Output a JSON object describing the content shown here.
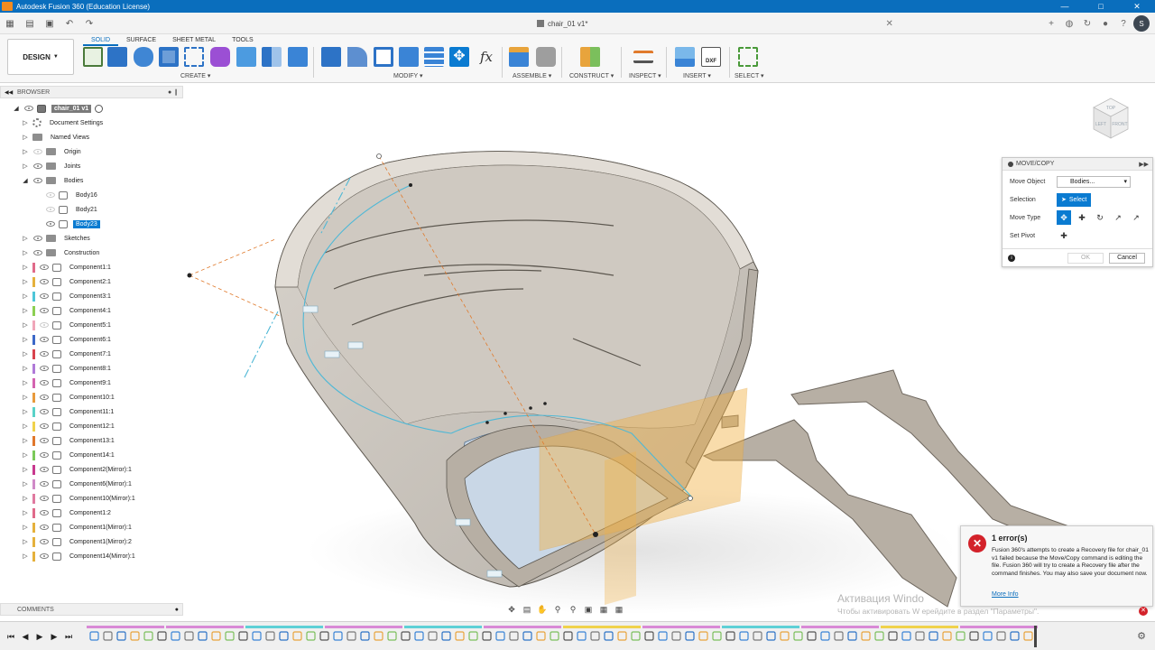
{
  "window": {
    "title": "Autodesk Fusion 360 (Education License)",
    "document_tab": "chair_01 v1*"
  },
  "user": {
    "initials": "S"
  },
  "ribbon": {
    "workspace": "DESIGN",
    "tabs": [
      "SOLID",
      "SURFACE",
      "SHEET METAL",
      "TOOLS"
    ],
    "active_tab": "SOLID",
    "groups": {
      "create": "CREATE",
      "modify": "MODIFY",
      "assemble": "ASSEMBLE",
      "construct": "CONSTRUCT",
      "inspect": "INSPECT",
      "insert": "INSERT",
      "select": "SELECT"
    },
    "fx_label": "fx",
    "dxf_label": "DXF"
  },
  "browser": {
    "header": "BROWSER",
    "root": "chair_01 v1",
    "items": [
      {
        "label": "Document Settings",
        "icon": "gear-icon"
      },
      {
        "label": "Named Views",
        "icon": "folder-icon"
      },
      {
        "label": "Origin",
        "icon": "folder-icon"
      },
      {
        "label": "Joints",
        "icon": "folder-icon"
      },
      {
        "label": "Bodies",
        "icon": "folder-icon"
      },
      {
        "label": "Body16",
        "icon": "body-icon"
      },
      {
        "label": "Body21",
        "icon": "body-icon"
      },
      {
        "label": "Body23",
        "icon": "body-icon"
      },
      {
        "label": "Sketches",
        "icon": "folder-icon"
      },
      {
        "label": "Construction",
        "icon": "folder-icon"
      }
    ],
    "components": [
      {
        "label": "Component1:1",
        "color": "#e06a8a"
      },
      {
        "label": "Component2:1",
        "color": "#e5b13c"
      },
      {
        "label": "Component3:1",
        "color": "#4ec6d8"
      },
      {
        "label": "Component4:1",
        "color": "#8ccf52"
      },
      {
        "label": "Component5:1",
        "color": "#f0a6b9"
      },
      {
        "label": "Component6:1",
        "color": "#3c68c8"
      },
      {
        "label": "Component7:1",
        "color": "#d8434e"
      },
      {
        "label": "Component8:1",
        "color": "#b07ad8"
      },
      {
        "label": "Component9:1",
        "color": "#d463b0"
      },
      {
        "label": "Component10:1",
        "color": "#e89a3c"
      },
      {
        "label": "Component11:1",
        "color": "#59d2c8"
      },
      {
        "label": "Component12:1",
        "color": "#f0d24c"
      },
      {
        "label": "Component13:1",
        "color": "#e0772c"
      },
      {
        "label": "Component14:1",
        "color": "#7bc95a"
      },
      {
        "label": "Component2(Mirror):1",
        "color": "#c8388e"
      },
      {
        "label": "Component6(Mirror):1",
        "color": "#d08ac8"
      },
      {
        "label": "Component10(Mirror):1",
        "color": "#e07aa0"
      },
      {
        "label": "Component1:2",
        "color": "#e06a8a"
      },
      {
        "label": "Component1(Mirror):1",
        "color": "#e5b13c"
      },
      {
        "label": "Component1(Mirror):2",
        "color": "#e5b13c"
      },
      {
        "label": "Component14(Mirror):1",
        "color": "#e5b13c"
      }
    ]
  },
  "comments": {
    "label": "COMMENTS"
  },
  "dialog": {
    "title": "MOVE/COPY",
    "move_object_label": "Move Object",
    "move_object_value": "Bodies...",
    "selection_label": "Selection",
    "selection_button": "Select",
    "move_type_label": "Move Type",
    "set_pivot_label": "Set Pivot",
    "ok": "OK",
    "cancel": "Cancel"
  },
  "error": {
    "title": "1 error(s)",
    "message": "Fusion 360's attempts to create a Recovery file for chair_01 v1 failed because the Move/Copy command is editing the file. Fusion 360 will try to create a Recovery file after the command finishes. You may also save your document now.",
    "link": "More Info"
  },
  "watermark": {
    "line1": "Активация Windo",
    "line2": "Чтобы активировать W          ерейдите в раздел \"Параметры\"."
  },
  "navcube": {
    "top": "TOP",
    "front": "FRONT",
    "left": "LEFT"
  },
  "colors": {
    "accent": "#0a6ebd",
    "selection": "#0a7bd1",
    "error": "#d3222a",
    "body_fill": "#c9c4bd",
    "plane": "#f2b247"
  }
}
